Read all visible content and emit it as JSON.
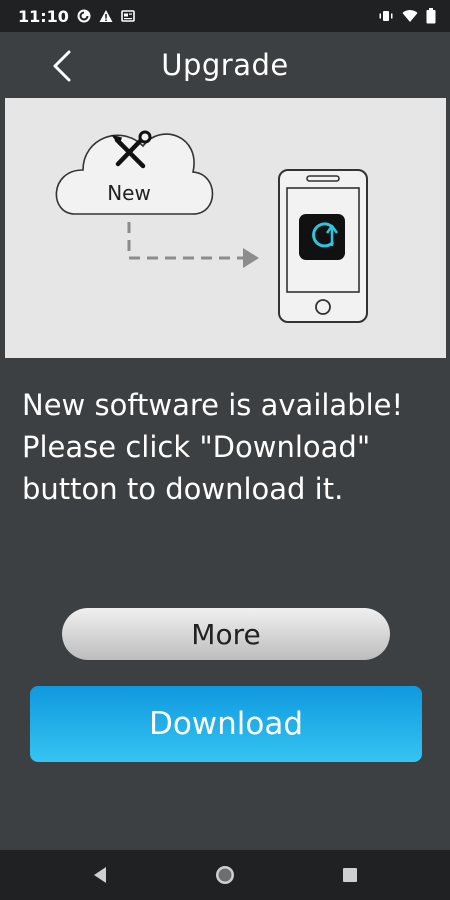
{
  "status_bar": {
    "time": "11:10",
    "left_icons": [
      "pocket-casts-icon",
      "warning-icon",
      "news-icon"
    ],
    "right_icons": [
      "vibrate-icon",
      "wifi-icon",
      "battery-icon"
    ]
  },
  "header": {
    "title": "Upgrade",
    "back_icon": "chevron-left-icon"
  },
  "illustration": {
    "cloud_label": "New",
    "cloud_icon": "tools-icon",
    "phone_app_icon": "upgrade-app-icon",
    "arrow": "dashed-arrow-icon"
  },
  "message": {
    "line1": "New software is available!",
    "line2": "Please click \"Download\"",
    "line3": "button to download it."
  },
  "buttons": {
    "more_label": "More",
    "download_label": "Download"
  },
  "nav_bar": {
    "icons": [
      "back-triangle-icon",
      "home-circle-icon",
      "recents-square-icon"
    ]
  },
  "colors": {
    "background": "#3d4042",
    "panel": "#e6e6e6",
    "download_top": "#0f99df",
    "download_bottom": "#35c4f2",
    "app_icon_bg": "#111111",
    "app_icon_accent": "#2ec6dd"
  }
}
